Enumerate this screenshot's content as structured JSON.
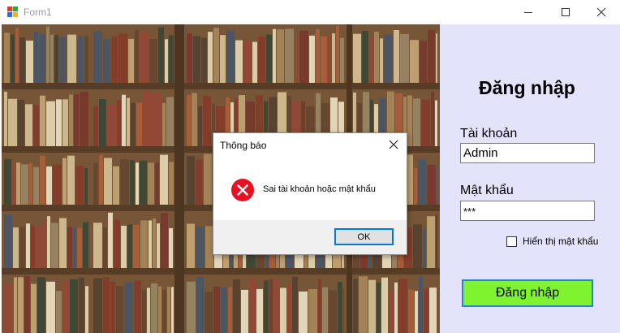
{
  "window": {
    "title": "Form1",
    "icons": [
      "app-icon",
      "minimize-icon",
      "maximize-icon",
      "close-icon"
    ]
  },
  "login": {
    "heading": "Đăng nhập",
    "username_label": "Tài khoản",
    "username_value": "Admin",
    "password_label": "Mật khẩu",
    "password_value": "***",
    "show_password_label": "Hiển thị mật khẩu",
    "show_password_checked": false,
    "submit_label": "Đăng nhập"
  },
  "dialog": {
    "title": "Thông báo",
    "message": "Sai tài khoản hoặc mật khẩu",
    "ok_label": "OK",
    "icon": "error-icon"
  },
  "colors": {
    "panel_bg": "#e3e3fb",
    "button_bg": "#7ff32f",
    "button_border": "#2a7fd8",
    "error_red": "#e81123",
    "focus_blue": "#0078d7"
  }
}
